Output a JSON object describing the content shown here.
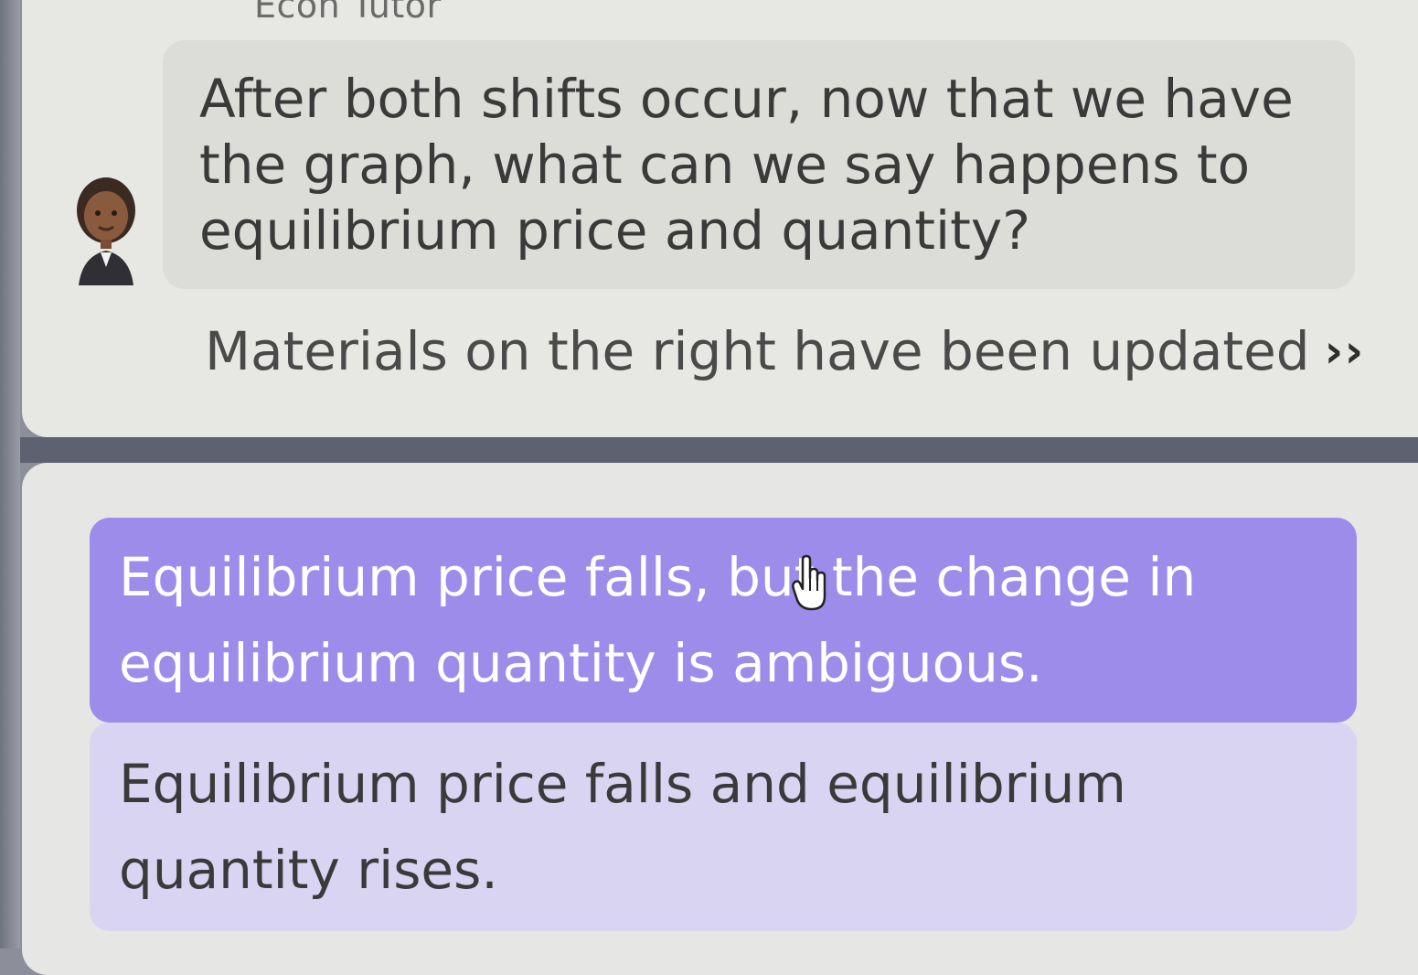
{
  "chat": {
    "sender": "Econ Tutor",
    "message": "After both shifts occur, now that we have the graph, what can we say happens to equilibrium price and quantity?",
    "update_notice": "Materials on the right have been updated",
    "update_icon": "double-chevron-right-icon"
  },
  "options": [
    {
      "label": "Equilibrium price falls, but the change in equilibrium quantity is ambiguous.",
      "selected": true
    },
    {
      "label": "Equilibrium price falls and equilibrium quantity rises.",
      "selected": false
    }
  ],
  "colors": {
    "selected_option": "#9d8cea",
    "unselected_option": "#d9d4f1",
    "panel_background": "#e6e6e4",
    "divider": "#5e6270"
  }
}
